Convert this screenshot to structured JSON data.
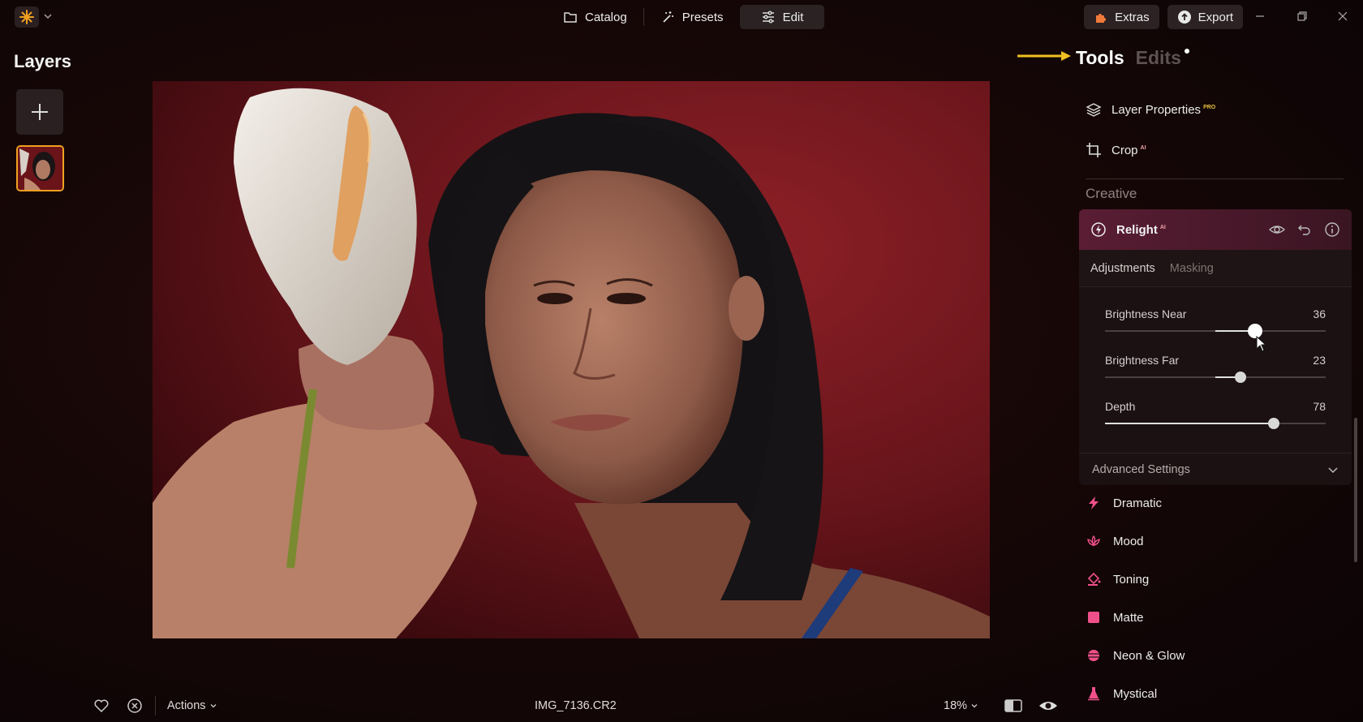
{
  "topbar": {
    "nav": [
      {
        "label": "Catalog",
        "icon": "folder-icon",
        "active": false
      },
      {
        "label": "Presets",
        "icon": "magic-wand-icon",
        "active": false
      },
      {
        "label": "Edit",
        "icon": "sliders-icon",
        "active": true
      }
    ],
    "extras_label": "Extras",
    "export_label": "Export"
  },
  "layers": {
    "title": "Layers"
  },
  "right_panel": {
    "tools_tab": "Tools",
    "edits_tab": "Edits",
    "tools": [
      {
        "label": "Layer Properties",
        "badge": "PRO",
        "icon": "layers-icon"
      },
      {
        "label": "Crop",
        "badge": "AI",
        "icon": "crop-icon"
      }
    ],
    "section_title": "Creative",
    "relight": {
      "title": "Relight",
      "badge": "AI",
      "tabs": [
        "Adjustments",
        "Masking"
      ],
      "sliders": [
        {
          "label": "Brightness Near",
          "value": "36",
          "position": 0.68
        },
        {
          "label": "Brightness Far",
          "value": "23",
          "position": 0.615
        },
        {
          "label": "Depth",
          "value": "78",
          "position": 0.765
        }
      ],
      "advanced_label": "Advanced Settings"
    },
    "categories": [
      {
        "label": "Dramatic",
        "icon": "lightning-icon"
      },
      {
        "label": "Mood",
        "icon": "lotus-icon"
      },
      {
        "label": "Toning",
        "icon": "paint-bucket-icon"
      },
      {
        "label": "Matte",
        "icon": "matte-square-icon"
      },
      {
        "label": "Neon & Glow",
        "icon": "neon-sphere-icon"
      },
      {
        "label": "Mystical",
        "icon": "potion-icon"
      }
    ]
  },
  "bottom": {
    "actions_label": "Actions",
    "filename": "IMG_7136.CR2",
    "zoom": "18%"
  },
  "colors": {
    "accent_pink": "#f0508a",
    "accent_orange": "#f0a020",
    "relight_header": "#5a1d34"
  }
}
